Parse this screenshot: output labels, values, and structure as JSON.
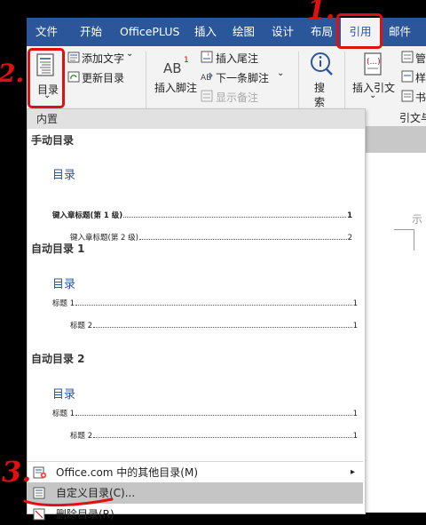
{
  "tabs": [
    {
      "label": "文件",
      "active": false
    },
    {
      "label": "开始",
      "active": false
    },
    {
      "label": "OfficePLUS",
      "active": false
    },
    {
      "label": "插入",
      "active": false
    },
    {
      "label": "绘图",
      "active": false
    },
    {
      "label": "设计",
      "active": false
    },
    {
      "label": "布局",
      "active": false
    },
    {
      "label": "引用",
      "active": true
    },
    {
      "label": "邮件",
      "active": false
    }
  ],
  "ribbon": {
    "toc_label": "目录",
    "toc_arrow": "⌄",
    "add_text_label": "添加文字",
    "add_text_arrow": "⌄",
    "update_toc_label": "更新目录",
    "insert_footnote_label": "插入脚注",
    "footnote_icon_text": "AB",
    "footnote_icon_sup": "1",
    "insert_endnote_label": "插入尾注",
    "next_footnote_label": "下一条脚注",
    "next_footnote_arrow": "⌄",
    "show_notes_label": "显示备注",
    "search_label_1": "搜",
    "search_label_2": "索",
    "insert_citation_label": "插入引文",
    "insert_citation_arrow": "⌄",
    "manage_label": "管",
    "style_label": "样",
    "bib_label": "书",
    "citation_group_label": "引文与"
  },
  "page_text": "示",
  "dropdown": {
    "builtin_header": "内置",
    "manual": {
      "name": "手动目录",
      "title": "目录",
      "entries": [
        {
          "label": "键入章标题(第 1 级)",
          "num": "1"
        },
        {
          "label": "键入章标题(第 2 级)",
          "num": "2"
        }
      ]
    },
    "auto1": {
      "name": "自动目录 1",
      "title": "目录",
      "entries": [
        {
          "label": "标题 1",
          "num": "1"
        },
        {
          "label": "标题 2",
          "num": "1"
        }
      ]
    },
    "auto2": {
      "name": "自动目录 2",
      "title": "目录",
      "entries": [
        {
          "label": "标题 1",
          "num": "1"
        },
        {
          "label": "标题 2",
          "num": "1"
        }
      ]
    },
    "menu": {
      "more_toc": "Office.com 中的其他目录(M)",
      "more_toc_arrow": "▸",
      "custom_toc": "自定义目录(C)...",
      "remove_toc": "删除目录(R)"
    }
  },
  "annotations": {
    "step1": "1.",
    "step2": "2.",
    "step3": "3.",
    "color": "#e01010"
  },
  "colors": {
    "tab_bar": "#2b579a",
    "ribbon": "#f3f3f3",
    "toc_title": "#2f5496",
    "highlight": "#c5c5c5"
  }
}
